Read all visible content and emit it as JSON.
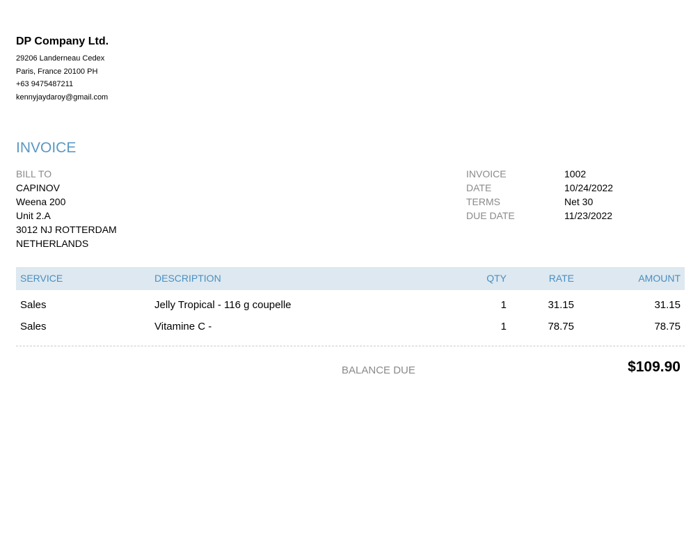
{
  "company": {
    "name": "DP Company Ltd.",
    "address1": "29206 Landerneau Cedex",
    "address2": "Paris, France  20100 PH",
    "phone": "+63 9475487211",
    "email": "kennyjaydaroy@gmail.com"
  },
  "invoice_title": "INVOICE",
  "bill_to": {
    "label": "BILL TO",
    "lines": [
      "CAPINOV",
      "Weena 200",
      "Unit 2.A",
      "3012 NJ ROTTERDAM",
      "NETHERLANDS"
    ]
  },
  "meta": [
    {
      "label": "INVOICE",
      "value": "1002"
    },
    {
      "label": "DATE",
      "value": "10/24/2022"
    },
    {
      "label": "TERMS",
      "value": "Net 30"
    },
    {
      "label": "DUE DATE",
      "value": "11/23/2022"
    }
  ],
  "table": {
    "headers": {
      "service": "SERVICE",
      "description": "DESCRIPTION",
      "qty": "QTY",
      "rate": "RATE",
      "amount": "AMOUNT"
    },
    "rows": [
      {
        "service": "Sales",
        "description": "Jelly Tropical - 116 g coupelle",
        "qty": "1",
        "rate": "31.15",
        "amount": "31.15"
      },
      {
        "service": "Sales",
        "description": "Vitamine C -",
        "qty": "1",
        "rate": "78.75",
        "amount": "78.75"
      }
    ]
  },
  "balance": {
    "label": "BALANCE DUE",
    "value": "$109.90"
  },
  "colors": {
    "accent": "#5a98c3",
    "header_bg": "#dde8f0",
    "muted": "#8a8a8a"
  }
}
